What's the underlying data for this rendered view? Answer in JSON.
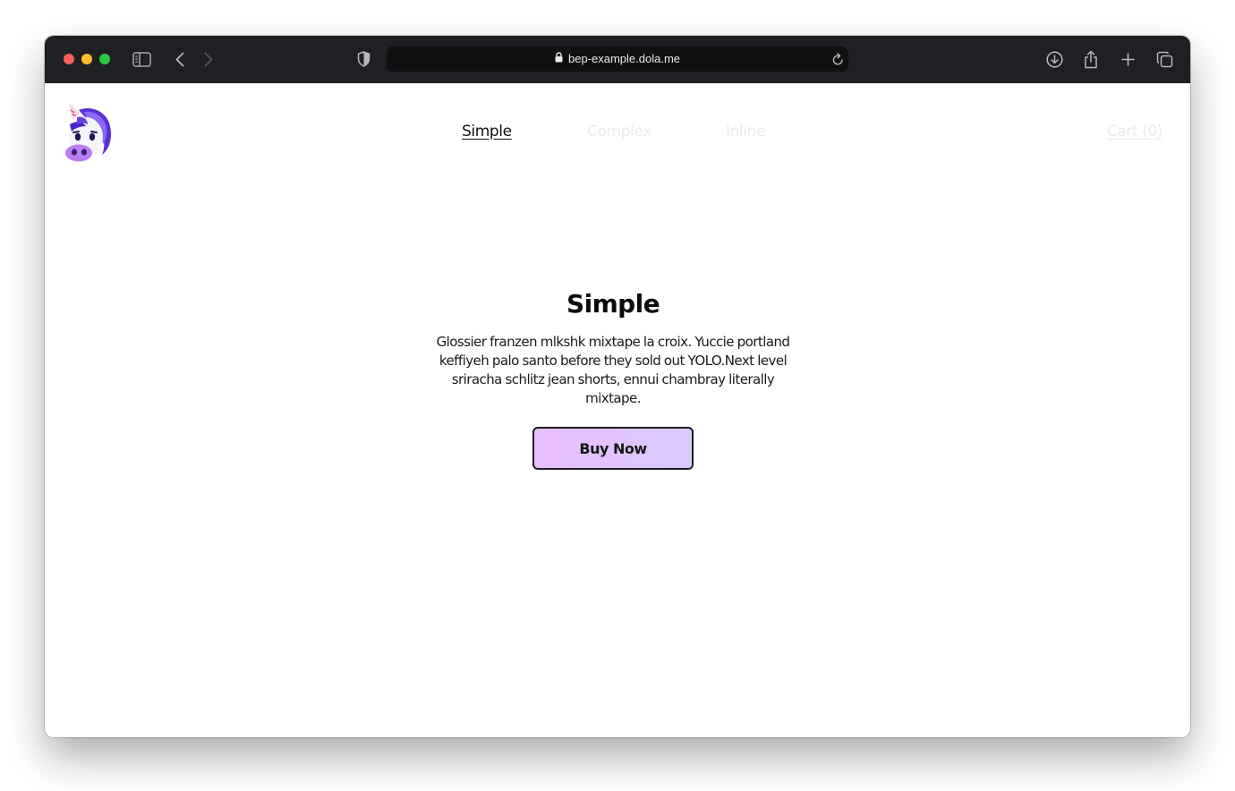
{
  "browser": {
    "url": "bep-example.dola.me",
    "traffic_lights": {
      "close_color": "#fe5f57",
      "minimize_color": "#febc2e",
      "maximize_color": "#28c840"
    },
    "icons": [
      "sidebar-icon",
      "back-icon",
      "forward-icon",
      "shield-icon",
      "lock-icon",
      "reload-icon",
      "download-icon",
      "share-icon",
      "new-tab-icon",
      "tabs-overview-icon"
    ]
  },
  "nav": {
    "logo": "unicorn-logo",
    "links": [
      {
        "label": "Simple",
        "active": true
      },
      {
        "label": "Complex",
        "active": false
      },
      {
        "label": "Inline",
        "active": false
      }
    ],
    "cart_label": "Cart (0)"
  },
  "hero": {
    "title": "Simple",
    "description": "Glossier franzen mlkshk mixtape la croix. Yuccie portland keffiyeh palo santo before they sold out YOLO.Next level sriracha schlitz jean shorts, ennui chambray literally mixtape.",
    "button_label": "Buy Now",
    "button_gradient": [
      "#eabdfd",
      "#d9cbfd"
    ]
  }
}
